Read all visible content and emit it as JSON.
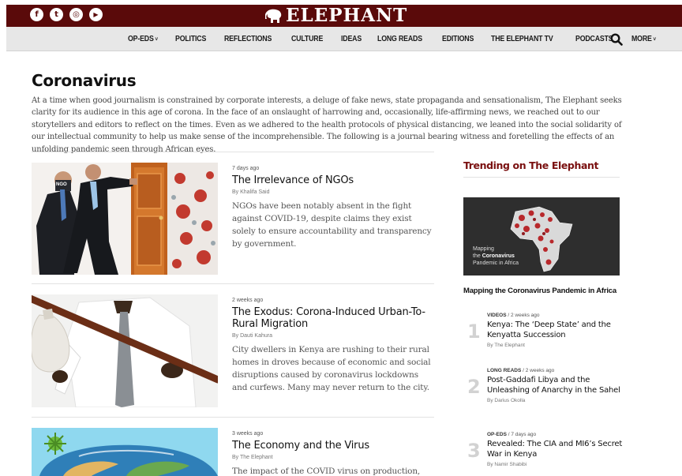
{
  "header": {
    "social": [
      {
        "name": "facebook-icon",
        "glyph": "f"
      },
      {
        "name": "twitter-icon",
        "glyph": "t"
      },
      {
        "name": "instagram-icon",
        "glyph": "◎"
      },
      {
        "name": "youtube-icon",
        "glyph": "▶"
      }
    ],
    "logo_text": "ELEPHANT",
    "brand_color": "#5a0a0a"
  },
  "nav": {
    "items": [
      {
        "label": "OP-EDS",
        "dropdown": true
      },
      {
        "label": "POLITICS",
        "dropdown": false
      },
      {
        "label": "REFLECTIONS",
        "dropdown": false
      },
      {
        "label": "CULTURE",
        "dropdown": false
      },
      {
        "label": "IDEAS",
        "dropdown": false
      },
      {
        "label": "LONG READS",
        "dropdown": false
      },
      {
        "label": "EDITIONS",
        "dropdown": false
      },
      {
        "label": "THE ELEPHANT TV",
        "dropdown": false
      },
      {
        "label": "PODCASTS",
        "dropdown": false
      },
      {
        "label": "MORE",
        "dropdown": true
      }
    ]
  },
  "page": {
    "title": "Coronavirus",
    "intro": "At a time when good journalism is constrained by corporate interests, a deluge of fake news, state propaganda and sensationalism, The Elephant seeks clarity for its audience in this age of corona. In the face of an onslaught of harrowing and, occasionally, life-affirming news, we reached out to our storytellers and editors to reflect on the times. Even as we adhered to the health protocols of physical distancing, we leaned into the social solidarity of our intellectual community to help us make sense of the incomprehensible. The following is a journal bearing witness and foretelling the effects of an unfolding pandemic seen through African eyes."
  },
  "articles": [
    {
      "when": "7 days ago",
      "headline": "The Irrelevance of NGOs",
      "byline": "By Khalifa Said",
      "excerpt": "NGOs have been notably absent in the fight against COVID-19, despite claims they exist solely to ensure accountability and transparency by government.",
      "image_label": "NGO"
    },
    {
      "when": "2 weeks ago",
      "headline": "The Exodus: Corona-Induced Urban-To-Rural Migration",
      "byline": "By Dauti Kahura",
      "excerpt": "City dwellers in Kenya are rushing to their rural homes in droves because of economic and social disruptions caused by coronavirus lockdowns and curfews. Many may never return to the city."
    },
    {
      "when": "3 weeks ago",
      "headline": "The Economy and the Virus",
      "byline": "By The Elephant",
      "excerpt": "The impact of the COVID virus on production,"
    }
  ],
  "sidebar": {
    "title": "Trending on The Elephant",
    "map_card": {
      "caption_line1": "Mapping",
      "caption_line2_prefix": "the",
      "caption_line2_bold": "Coronavirus",
      "caption_line3": "Pandemic in Africa"
    },
    "map_link": "Mapping the Coronavirus Pandemic in Africa",
    "trending": [
      {
        "num": "1",
        "category": "VIDEOS",
        "when": "2 weeks ago",
        "headline": "Kenya: The ‘Deep State’ and the Kenyatta Succession",
        "byline": "By The Elephant"
      },
      {
        "num": "2",
        "category": "LONG READS",
        "when": "2 weeks ago",
        "headline": "Post-Gaddafi Libya and the Unleashing of Anarchy in the Sahel",
        "byline": "By Darius Okolla"
      },
      {
        "num": "3",
        "category": "OP-EDS",
        "when": "7 days ago",
        "headline": "Revealed: The CIA and MI6’s Secret War in Kenya",
        "byline": "By Namir Shabibi"
      }
    ]
  }
}
